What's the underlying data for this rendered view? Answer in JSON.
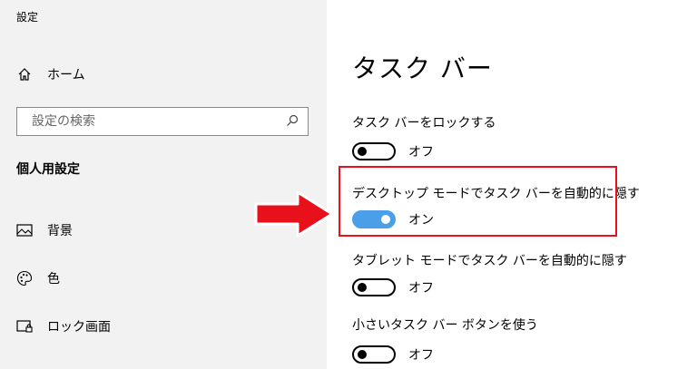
{
  "app": {
    "title": "設定"
  },
  "sidebar": {
    "home_label": "ホーム",
    "search_placeholder": "設定の検索",
    "section_heading": "個人用設定",
    "items": [
      {
        "label": "背景",
        "icon": "picture-icon"
      },
      {
        "label": "色",
        "icon": "palette-icon"
      },
      {
        "label": "ロック画面",
        "icon": "lock-screen-icon"
      }
    ]
  },
  "main": {
    "title": "タスク バー",
    "settings": [
      {
        "label": "タスク バーをロックする",
        "state": "オフ",
        "on": false
      },
      {
        "label": "デスクトップ モードでタスク バーを自動的に隠す",
        "state": "オン",
        "on": true
      },
      {
        "label": "タブレット モードでタスク バーを自動的に隠す",
        "state": "オフ",
        "on": false
      },
      {
        "label": "小さいタスク バー ボタンを使う",
        "state": "オフ",
        "on": false
      }
    ]
  },
  "colors": {
    "sidebar_bg": "#f2f2f2",
    "toggle_on": "#4a9fe8",
    "highlight": "#e8101a"
  }
}
